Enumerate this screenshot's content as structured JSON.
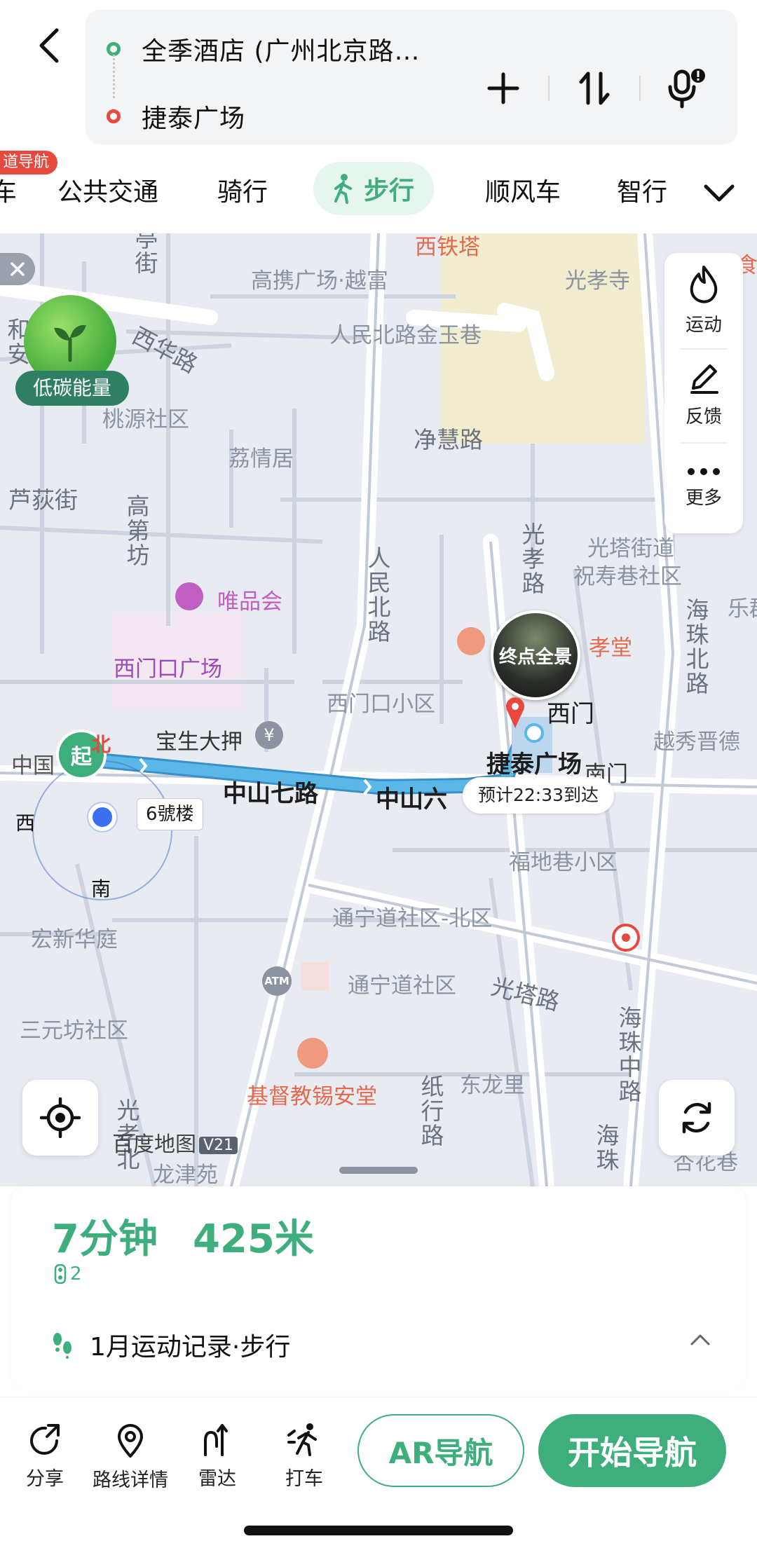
{
  "header": {
    "origin": "全季酒店 (广州北京路…",
    "destination": "捷泰广场",
    "icons": [
      "back-icon",
      "plus-icon",
      "swap-icon",
      "mic-icon"
    ]
  },
  "tabs": {
    "badge": "道导航",
    "items": [
      {
        "label": "车"
      },
      {
        "label": "公共交通"
      },
      {
        "label": "骑行"
      },
      {
        "label": "步行",
        "active": true
      },
      {
        "label": "顺风车"
      },
      {
        "label": "智行"
      }
    ]
  },
  "map": {
    "eco_label": "低碳能量",
    "side_panel": {
      "sport": "运动",
      "feedback": "反馈",
      "more": "更多"
    },
    "labels": {
      "xitieta": "西铁塔",
      "gaoxie": "高携广场·越富",
      "guangxiaosi": "光孝寺",
      "shi": "食",
      "renminbei_jinyu": "人民北路金玉巷",
      "xihua": "西华路",
      "he": "和安",
      "taoyuan": "桃源社区",
      "jinghui": "净慧路",
      "liqing": "荔情居",
      "ludijie": "芦荻街",
      "gaodifang": "高第坊",
      "renminbeilu": "人民北路",
      "guangxiaolu": "光孝路",
      "guangtajie": "光塔街道",
      "zhushou": "祝寿巷社区",
      "le": "乐郡",
      "weipin": "唯品会",
      "haizhubeilu": "海珠北路",
      "ximenkou_plaza": "西门口广场",
      "xiaotang": "孝堂",
      "ximenkou_xq": "西门口小区",
      "ximen": "西门",
      "baosheng": "宝生大押",
      "yuexiu": "越秀晋德",
      "zhongguo": "中国",
      "jietai": "捷泰广场",
      "nanmen": "南门",
      "zhongshan7": "中山七路",
      "zhongshan6": "中山六",
      "fudixiang": "福地巷小区",
      "hongxin": "宏新华庭",
      "tongning_n": "通宁道社区-北区",
      "tongning": "通宁道社区",
      "guangtalu": "光塔路",
      "sanyuanfang": "三元坊社区",
      "haizhuzhonglu": "海珠中路",
      "jidu": "基督教锡安堂",
      "donglongli": "东龙里",
      "zhixinglu": "纸行路",
      "guangxiaobei": "光孝北",
      "longjin": "龙津苑",
      "xinghua": "杏花巷",
      "haizhu_bottom": "海珠",
      "atm": "ATM"
    },
    "panorama": "终点全景",
    "eta": "预计22:33到达",
    "start_pin": "起",
    "north": "北",
    "west": "西",
    "south": "南",
    "building": "6號楼",
    "brand": "百度地图",
    "brand_scale": "V21"
  },
  "summary": {
    "time": "7分钟",
    "distance": "425米",
    "lights": "2",
    "record": "1月运动记录·步行"
  },
  "actions": {
    "share": "分享",
    "route_detail": "路线详情",
    "radar": "雷达",
    "taxi": "打车",
    "ar": "AR导航",
    "start": "开始导航"
  },
  "colors": {
    "accent": "#3fae7d",
    "destination": "#e8493e",
    "route_line": "#5ab7e8"
  }
}
